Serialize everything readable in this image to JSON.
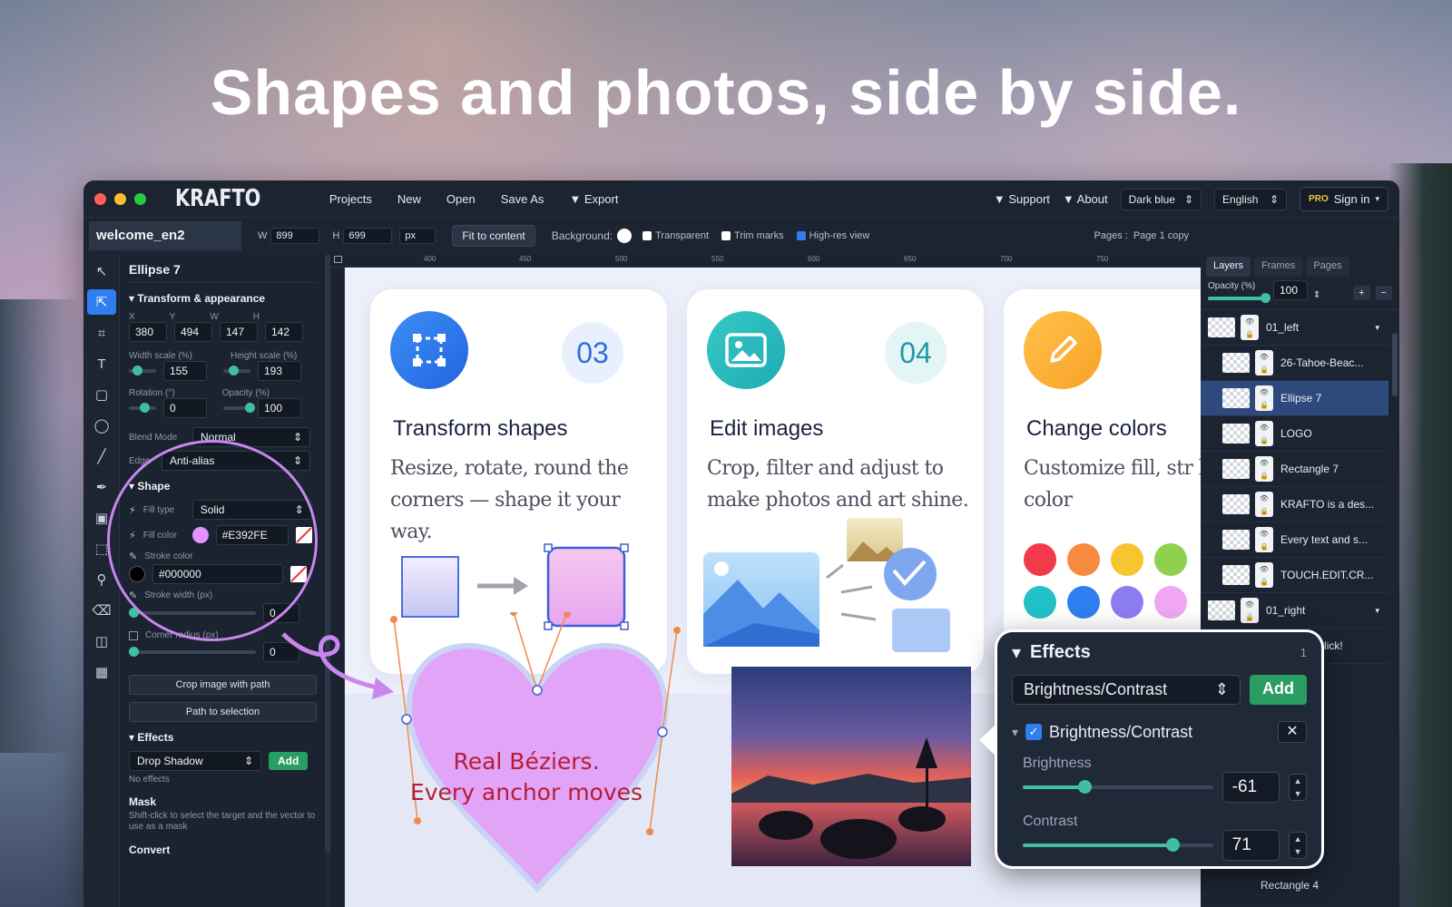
{
  "headline": "Shapes and photos, side by side.",
  "app": {
    "logo": "KRAFTO",
    "menu": [
      "Projects",
      "New",
      "Open",
      "Save As",
      "▼ Export"
    ],
    "support": "▼ Support",
    "about": "▼ About",
    "theme": "Dark blue",
    "language": "English",
    "pro_badge": "PRO",
    "signin": "Sign in"
  },
  "toolbar": {
    "doc_name": "welcome_en2",
    "w_label": "W",
    "w_value": "899",
    "h_label": "H",
    "h_value": "699",
    "unit": "px",
    "fit_button": "Fit to content",
    "background_label": "Background:",
    "transparent": "Transparent",
    "trim_marks": "Trim marks",
    "hires": "High-res view",
    "pages_label": "Pages :",
    "pages_value": "Page 1 copy"
  },
  "props": {
    "title": "Ellipse 7",
    "transform_section": "Transform & appearance",
    "x_label": "X",
    "x": "380",
    "y_label": "Y",
    "y": "494",
    "w_label": "W",
    "w": "147",
    "h_label": "H",
    "h": "142",
    "width_scale_label": "Width scale (%)",
    "width_scale": "155",
    "height_scale_label": "Height scale (%)",
    "height_scale": "193",
    "rotation_label": "Rotation (°)",
    "rotation": "0",
    "opacity_label": "Opacity (%)",
    "opacity": "100",
    "blend_label": "Blend Mode",
    "blend": "Normal",
    "edge_label": "Edge",
    "edge": "Anti-alias",
    "shape_section": "Shape",
    "fill_type_label": "Fill type",
    "fill_type": "Solid",
    "fill_color_label": "Fill color",
    "fill_color": "#E392FE",
    "stroke_color_label": "Stroke color",
    "stroke_color": "#000000",
    "stroke_width_label": "Stroke width (px)",
    "stroke_width": "0",
    "corner_radius_label": "Corner radius (px)",
    "corner_radius": "0",
    "crop_btn": "Crop image with path",
    "path_btn": "Path to selection",
    "effects_section": "Effects",
    "effect_select": "Drop Shadow",
    "add": "Add",
    "no_effects": "No effects",
    "mask_section": "Mask",
    "mask_hint": "Shift-click to select the target and the vector to use as a mask",
    "convert_section": "Convert"
  },
  "ruler": [
    "400",
    "450",
    "500",
    "550",
    "600",
    "650",
    "700",
    "750"
  ],
  "cards": [
    {
      "num": "03",
      "title": "Transform shapes",
      "body": "Resize, rotate, round the corners — shape it your way."
    },
    {
      "num": "04",
      "title": "Edit images",
      "body": "Crop, filter and adjust to make photos and art shine."
    },
    {
      "num": "",
      "title": "Change colors",
      "body": "Customize fill, str background color"
    }
  ],
  "heart_label": {
    "line1": "Real Béziers.",
    "line2": "Every anchor moves"
  },
  "layers": {
    "tabs": [
      "Layers",
      "Frames",
      "Pages"
    ],
    "opacity_label": "Opacity (%)",
    "opacity": "100",
    "items": [
      {
        "name": "01_left"
      },
      {
        "name": "26-Tahoe-Beac..."
      },
      {
        "name": "Ellipse 7"
      },
      {
        "name": "LOGO"
      },
      {
        "name": "Rectangle 7"
      },
      {
        "name": "KRAFTO is a des..."
      },
      {
        "name": "Every text and s..."
      },
      {
        "name": "TOUCH.EDIT.CR..."
      },
      {
        "name": "01_right"
      },
      {
        "name": "Double-click!"
      }
    ],
    "bottom_item": "Rectangle 4"
  },
  "effects_panel": {
    "title": "Effects",
    "count": "1",
    "select": "Brightness/Contrast",
    "add": "Add",
    "item": "Brightness/Contrast",
    "brightness_label": "Brightness",
    "brightness": "-61",
    "brightness_level": 0.32,
    "contrast_label": "Contrast",
    "contrast": "71",
    "contrast_level": 0.78
  },
  "colors": {
    "swatches": [
      "#f23a4b",
      "#f78a3f",
      "#f7c52e",
      "#8fd14f",
      "#22c1c9",
      "#2f7ff0",
      "#8b7cf0",
      "#f0a6f2"
    ]
  }
}
